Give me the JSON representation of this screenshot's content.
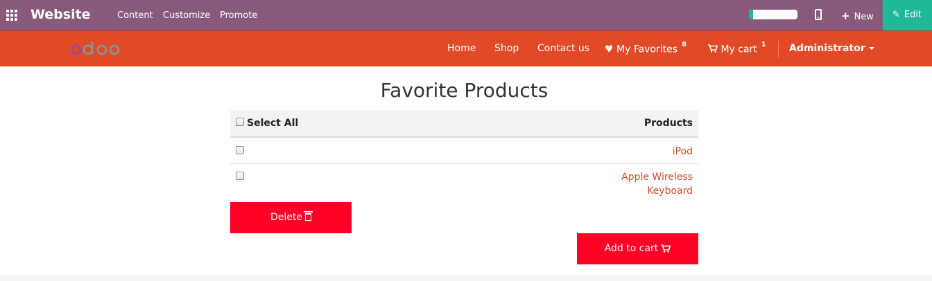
{
  "admin_bar": {
    "title": "Website",
    "menus": [
      "Content",
      "Customize",
      "Promote"
    ],
    "progress_fraction": 0.08,
    "new_label": "New",
    "edit_label": "Edit",
    "color": "#875a7b",
    "edit_color": "#21b799"
  },
  "navbar": {
    "color": "#e04a27",
    "links": [
      "Home",
      "Shop",
      "Contact us"
    ],
    "favorites_label": "My Favorites",
    "favorites_count": "8",
    "cart_label": "My cart",
    "cart_count": "1",
    "user_label": "Administrator"
  },
  "main": {
    "title": "Favorite Products",
    "table": {
      "select_all_label": "Select All",
      "products_header": "Products",
      "rows": [
        {
          "product": "iPod"
        },
        {
          "product": "Apple Wireless Keyboard"
        }
      ]
    },
    "delete_label": "Delete",
    "add_to_cart_label": "Add to cart",
    "button_color": "#ff0026"
  },
  "icons": [
    "apps-grid-icon",
    "mobile-preview-icon",
    "plus-icon",
    "pencil-icon",
    "heart-icon",
    "cart-icon",
    "caret-down-icon",
    "trash-icon"
  ]
}
